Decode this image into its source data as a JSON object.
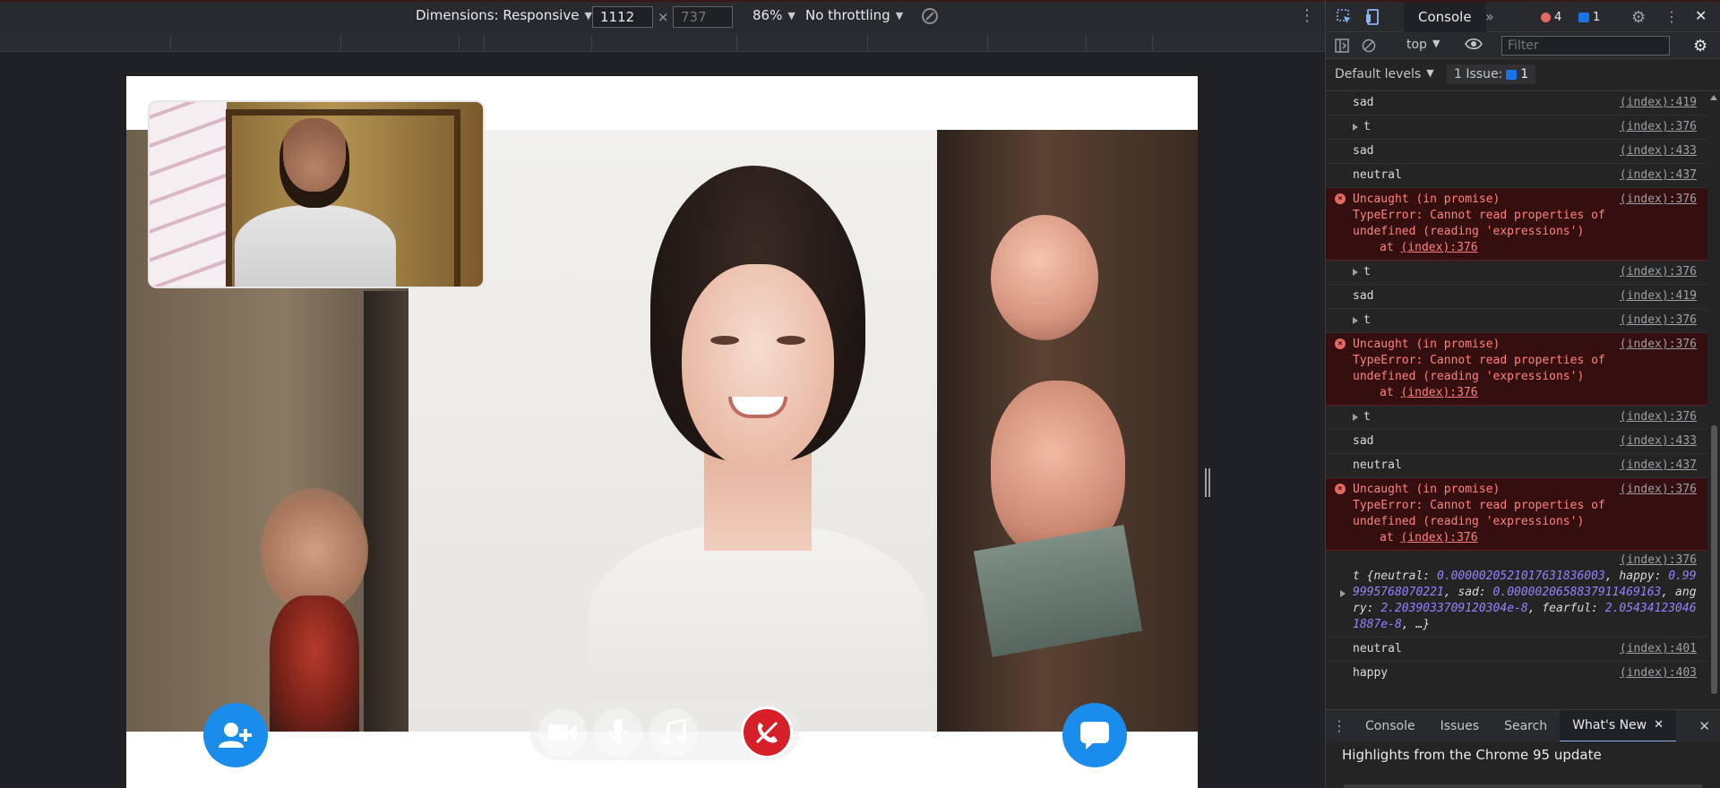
{
  "device_toolbar": {
    "dimensions_label": "Dimensions: Responsive",
    "width_value": "1112",
    "times": "×",
    "height_placeholder": "737",
    "zoom_label": "86%",
    "throttling_label": "No throttling"
  },
  "devtools": {
    "tabs": {
      "active_tab": "Console",
      "more_tabs": "»",
      "error_count": "4",
      "message_count": "1"
    },
    "toolbar": {
      "context": "top",
      "filter_placeholder": "Filter"
    },
    "levels": {
      "default_levels": "Default levels",
      "issues_label": "1 Issue:",
      "issues_count": "1"
    },
    "console_rows": [
      {
        "type": "log",
        "text": "sad",
        "src": "(index):419"
      },
      {
        "type": "expand",
        "text": "t",
        "src": "(index):376"
      },
      {
        "type": "log",
        "text": "sad",
        "src": "(index):433"
      },
      {
        "type": "log",
        "text": "neutral",
        "src": "(index):437"
      },
      {
        "type": "error",
        "line1": "Uncaught (in promise)",
        "line2": "TypeError: Cannot read properties of",
        "line3": "undefined (reading 'expressions')",
        "line4_prefix": "at ",
        "line4_link": "(index):376",
        "src": "(index):376"
      },
      {
        "type": "expand",
        "text": "t",
        "src": "(index):376"
      },
      {
        "type": "log",
        "text": "sad",
        "src": "(index):419"
      },
      {
        "type": "expand",
        "text": "t",
        "src": "(index):376"
      },
      {
        "type": "error",
        "line1": "Uncaught (in promise)",
        "line2": "TypeError: Cannot read properties of",
        "line3": "undefined (reading 'expressions')",
        "line4_prefix": "at ",
        "line4_link": "(index):376",
        "src": "(index):376"
      },
      {
        "type": "expand",
        "text": "t",
        "src": "(index):376"
      },
      {
        "type": "log",
        "text": "sad",
        "src": "(index):433"
      },
      {
        "type": "log",
        "text": "neutral",
        "src": "(index):437"
      },
      {
        "type": "error",
        "line1": "Uncaught (in promise)",
        "line2": "TypeError: Cannot read properties of",
        "line3": "undefined (reading 'expressions')",
        "line4_prefix": "at ",
        "line4_link": "(index):376",
        "src": "(index):376"
      }
    ],
    "object_row": {
      "src": "(index):376",
      "prefix": "t {",
      "k_neutral": "neutral: ",
      "v_neutral": "0.0000020521017631836003",
      "k_happy": ", happy: ",
      "v_happy": "0.999995768070221",
      "k_sad": ", sad: ",
      "v_sad": "0.0000020658837911469163",
      "k_angry": ", angry: ",
      "v_angry": "2.2039033709120304e-8",
      "k_fearful": ", fearful: ",
      "v_fearful": "2.054341230461887e-8",
      "suffix": ", …}"
    },
    "tail_rows": [
      {
        "text": "neutral",
        "src": "(index):401"
      },
      {
        "text": "happy",
        "src": "(index):403"
      }
    ],
    "prompt": "›",
    "drawer": {
      "tabs": [
        "Console",
        "Issues",
        "Search",
        "What's New"
      ],
      "active_tab": "What's New",
      "highlight": "Highlights from the Chrome 95 update"
    }
  },
  "colors": {
    "accent_blue": "#1a8ceb",
    "end_call_red": "#d61f28",
    "error_bg": "#350f0f",
    "error_text": "#ff8080"
  }
}
